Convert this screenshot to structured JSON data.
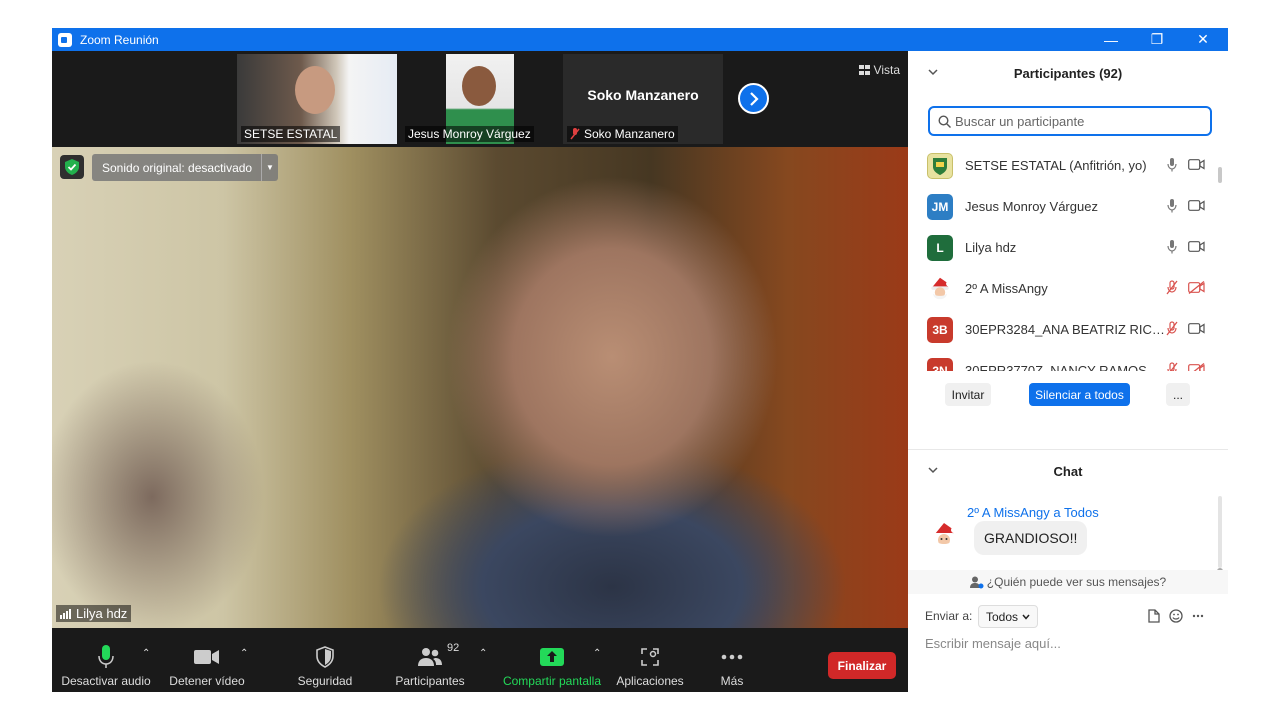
{
  "window": {
    "title": "Zoom Reunión",
    "minimize_glyph": "—",
    "restore_glyph": "❐",
    "close_glyph": "✕"
  },
  "thumbnails": [
    {
      "name": "SETSE ESTATAL"
    },
    {
      "name": "Jesus Monroy Várguez"
    },
    {
      "name": "Soko Manzanero",
      "big_label": "Soko Manzanero"
    }
  ],
  "view_button": "Vista",
  "video": {
    "original_sound": "Sonido original: desactivado",
    "active_speaker": "Lilya hdz"
  },
  "toolbar": {
    "mute": "Desactivar audio",
    "video": "Detener vídeo",
    "security": "Seguridad",
    "participants": "Participantes",
    "participants_count": "92",
    "share": "Compartir pantalla",
    "apps": "Aplicaciones",
    "more": "Más",
    "end": "Finalizar"
  },
  "participants_panel": {
    "title": "Participantes (92)",
    "search_placeholder": "Buscar un participante",
    "list": [
      {
        "initials": "",
        "name": "SETSE ESTATAL (Anfitrión, yo)",
        "color": "#c9c06a",
        "muted": false
      },
      {
        "initials": "JM",
        "name": "Jesus Monroy Várguez",
        "color": "#2d7ec4",
        "muted": false
      },
      {
        "initials": "L",
        "name": "Lilya hdz",
        "color": "#1f6d3c",
        "muted": false
      },
      {
        "initials": "",
        "name": "2º A  MissAngy",
        "color": "#ffffff",
        "muted": true
      },
      {
        "initials": "3B",
        "name": "30EPR3284_ANA BEATRIZ RICAR...",
        "color": "#c83a2c",
        "muted": true
      },
      {
        "initials": "3N",
        "name": "30EPR3770Z_NANCY RAMOS",
        "color": "#c83a2c",
        "muted": true
      }
    ],
    "invite": "Invitar",
    "mute_all": "Silenciar a todos",
    "more": "..."
  },
  "chat": {
    "title": "Chat",
    "message_from": "2º A  MissAngy a Todos",
    "message_text": "GRANDIOSO!!",
    "who_sees": "¿Quién puede ver sus mensajes?",
    "send_to_label": "Enviar a:",
    "send_to_value": "Todos",
    "input_placeholder": "Escribir mensaje aquí..."
  },
  "colors": {
    "accent": "#0e71eb",
    "end_button": "#d12828",
    "share_green": "#23d959"
  }
}
